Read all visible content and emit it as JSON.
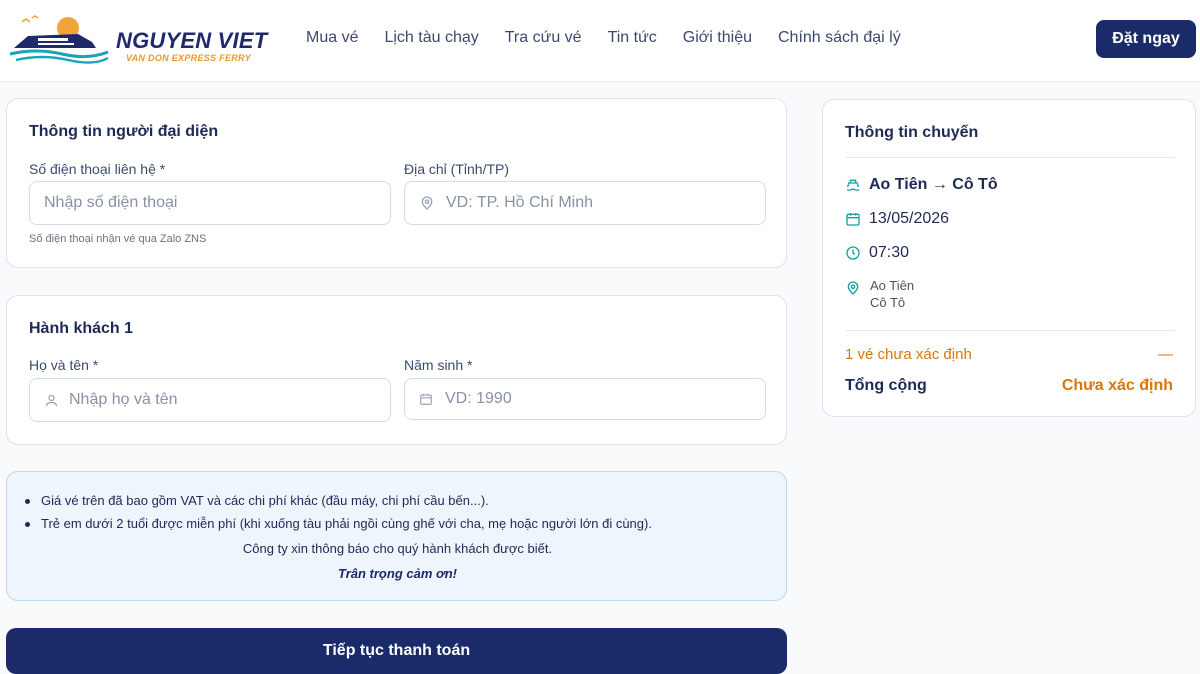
{
  "header": {
    "brand_name": "NGUYEN VIET",
    "brand_tagline": "VAN DON EXPRESS FERRY",
    "nav": [
      "Mua vé",
      "Lịch tàu chạy",
      "Tra cứu vé",
      "Tin tức",
      "Giới thiệu",
      "Chính sách đại lý"
    ],
    "book_label": "Đặt ngay"
  },
  "representative": {
    "title": "Thông tin người đại diện",
    "phone_label": "Số điện thoại liên hệ *",
    "phone_placeholder": "Nhập số điện thoại",
    "phone_hint": "Số điện thoại nhận vé qua Zalo ZNS",
    "address_label": "Địa chỉ (Tỉnh/TP)",
    "address_placeholder": "VD: TP. Hồ Chí Minh"
  },
  "passenger": {
    "title": "Hành khách 1",
    "name_label": "Họ và tên *",
    "name_placeholder": "Nhập họ và tên",
    "birth_label": "Năm sinh *",
    "birth_placeholder": "VD: 1990"
  },
  "notice": {
    "items": [
      "Giá vé trên đã bao gồm VAT và các chi phí khác (đầu máy, chi phí cầu bến...).",
      "Trẻ em dưới 2 tuổi được miễn phí (khi xuống tàu phải ngồi cùng ghế với cha, mẹ hoặc người lớn đi cùng)."
    ],
    "announce": "Công ty xin thông báo cho quý hành khách được biết.",
    "thanks": "Trân trọng cảm ơn!"
  },
  "pay_label": "Tiếp tục thanh toán",
  "trip": {
    "title": "Thông tin chuyến",
    "route": "Ao Tiên → Cô Tô",
    "date": "13/05/2026",
    "time": "07:30",
    "from": "Ao Tiên",
    "to": "Cô Tô",
    "ticket_line": "1 vé chưa xác định",
    "ticket_price": "—",
    "total_label": "Tổng cộng",
    "total_value": "Chưa xác định"
  },
  "colors": {
    "primary": "#1b2a68",
    "accent_orange": "#d97706",
    "teal_icon": "#14a0a0",
    "notice_bg": "#eef5fc"
  }
}
